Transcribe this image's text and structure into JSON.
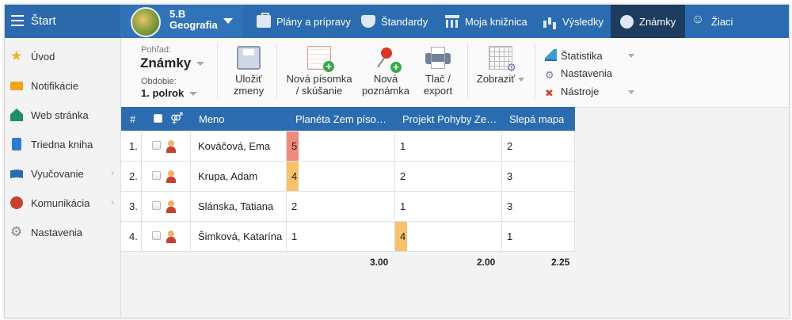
{
  "topbar": {
    "start_label": "Štart",
    "class_name": "5.B",
    "subject": "Geografia",
    "nav": [
      {
        "label": "Plány a prípravy",
        "icon": "briefcase-icon",
        "active": false
      },
      {
        "label": "Štandardy",
        "icon": "shield-icon",
        "active": false
      },
      {
        "label": "Moja knižnica",
        "icon": "library-icon",
        "active": false
      },
      {
        "label": "Výsledky",
        "icon": "bar-chart-icon",
        "active": false
      },
      {
        "label": "Známky",
        "icon": "grades-icon",
        "active": true
      },
      {
        "label": "Žiaci",
        "icon": "students-icon",
        "active": false
      }
    ]
  },
  "sidebar": {
    "items": [
      {
        "label": "Úvod",
        "icon": "star-icon"
      },
      {
        "label": "Notifikácie",
        "icon": "envelope-icon"
      },
      {
        "label": "Web stránka",
        "icon": "house-icon"
      },
      {
        "label": "Triedna kniha",
        "icon": "book-icon"
      },
      {
        "label": "Vyučovanie",
        "icon": "open-book-icon",
        "chevron": "›"
      },
      {
        "label": "Komunikácia",
        "icon": "chat-icon",
        "chevron": "›"
      },
      {
        "label": "Nastavenia",
        "icon": "gear-icon"
      }
    ]
  },
  "toolbar": {
    "view_label": "Pohľad:",
    "view_value": "Známky",
    "period_label": "Obdobie:",
    "period_value": "1. polrok",
    "save_line1": "Uložiť",
    "save_line2": "zmeny",
    "new_exam_line1": "Nová písomka",
    "new_exam_line2": "/ skúšanie",
    "new_note_line1": "Nová",
    "new_note_line2": "poznámka",
    "print_line1": "Tlač /",
    "print_line2": "export",
    "show_label": "Zobraziť",
    "menu": [
      {
        "label": "Štatistika",
        "has_caret": true
      },
      {
        "label": "Nastavenia",
        "has_caret": false
      },
      {
        "label": "Nástroje",
        "has_caret": true
      }
    ]
  },
  "table": {
    "headers": {
      "num": "#",
      "gender": "⚤",
      "name": "Meno",
      "col1": "Planéta Zem píso…",
      "col2": "Projekt Pohyby Ze…",
      "col3": "Slepá mapa"
    },
    "rows": [
      {
        "num": "1.",
        "name": "Kováčová, Ema",
        "g1": "5",
        "g2": "1",
        "g3": "2",
        "mark1": "#f08a7a",
        "mark2": "",
        "mark3": ""
      },
      {
        "num": "2.",
        "name": "Krupa, Adam",
        "g1": "4",
        "g2": "2",
        "g3": "3",
        "mark1": "#f9c26a",
        "mark2": "",
        "mark3": ""
      },
      {
        "num": "3.",
        "name": "Slánska, Tatiana",
        "g1": "2",
        "g2": "1",
        "g3": "3",
        "mark1": "",
        "mark2": "",
        "mark3": ""
      },
      {
        "num": "4.",
        "name": "Šimková, Katarína",
        "g1": "1",
        "g2": "4",
        "g3": "1",
        "mark1": "",
        "mark2": "#f9c26a",
        "mark3": ""
      }
    ],
    "averages": {
      "col1": "3.00",
      "col2": "2.00",
      "col3": "2.25"
    }
  },
  "colors": {
    "topbar": "#2b6cb0",
    "active_nav": "#1d3c5f",
    "header": "#2b6cb0"
  }
}
